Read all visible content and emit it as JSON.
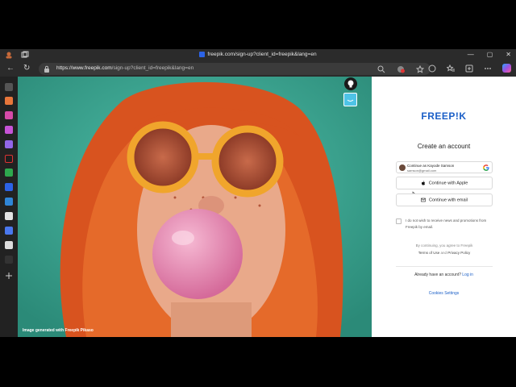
{
  "browser": {
    "tab_title": "freepik.com/sign-up?client_id=freepik&lang=en",
    "url_domain": "https://www.freepik.com",
    "url_path": "/sign-up?client_id=freepik&lang=en",
    "window_controls": {
      "minimize": "—",
      "maximize": "▢",
      "close": "✕"
    },
    "nav": {
      "back": "←",
      "refresh": "↻"
    }
  },
  "hero": {
    "credit": "Image generated with Freepik Pikaso"
  },
  "panel": {
    "logo": "FREEP!K",
    "heading": "Create an account",
    "google": {
      "line1": "Continue as Kayode Samson",
      "line2": "samson@gmail.com"
    },
    "apple_label": "Continue with Apple",
    "email_label": "Continue with email",
    "checkbox_label": "I do not wish to receive news and promotions from Freepik by email.",
    "legal_prefix": "By continuing, you agree to Freepik",
    "terms": "Terms of Use",
    "legal_and": "and",
    "privacy": "Privacy Policy",
    "have_account": "Already have an account?",
    "login": "Log in",
    "cookies": "Cookies Settings"
  },
  "colors": {
    "brand": "#1b5fc7",
    "teal_bg": "#3aa894",
    "chrome": "#2b2b2b"
  }
}
